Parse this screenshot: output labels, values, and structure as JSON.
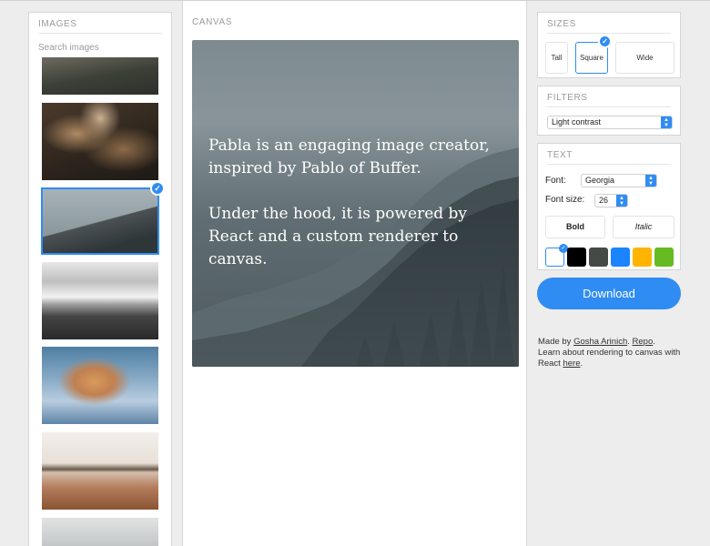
{
  "images": {
    "title": "IMAGES",
    "search_placeholder": "Search images",
    "thumbnails": [
      {
        "name": "thumb-dusk-landscape"
      },
      {
        "name": "thumb-dried-plants"
      },
      {
        "name": "thumb-foggy-forest",
        "selected": true
      },
      {
        "name": "thumb-sea-of-clouds"
      },
      {
        "name": "thumb-sleeping-cat"
      },
      {
        "name": "thumb-beach"
      },
      {
        "name": "thumb-rocks"
      }
    ]
  },
  "canvas": {
    "title": "CANVAS",
    "text": "Pabla is an engaging image creator,\ninspired by Pablo of Buffer.\n\nUnder the hood, it is powered by\nReact and a custom renderer to\ncanvas."
  },
  "sizes": {
    "title": "SIZES",
    "options": [
      {
        "label": "Tall"
      },
      {
        "label": "Square",
        "active": true
      },
      {
        "label": "Wide"
      }
    ]
  },
  "filters": {
    "title": "FILTERS",
    "selected": "Light contrast"
  },
  "text": {
    "title": "TEXT",
    "font_label": "Font:",
    "font_value": "Georgia",
    "font_size_label": "Font size:",
    "font_size_value": "26",
    "bold_label": "Bold",
    "italic_label": "Italic",
    "colors": [
      "#ffffff",
      "#000000",
      "#454a47",
      "#1a85ff",
      "#ffb400",
      "#66bb22"
    ],
    "selected_color": "#ffffff"
  },
  "download_label": "Download",
  "credits": {
    "made_by": "Made by ",
    "author": "Gosha Arinich",
    "sep": ". ",
    "repo": "Repo",
    "dot": ".",
    "learn": "Learn about rendering to canvas with React ",
    "here": "here",
    "end": "."
  },
  "accent_color": "#2f8cf3"
}
